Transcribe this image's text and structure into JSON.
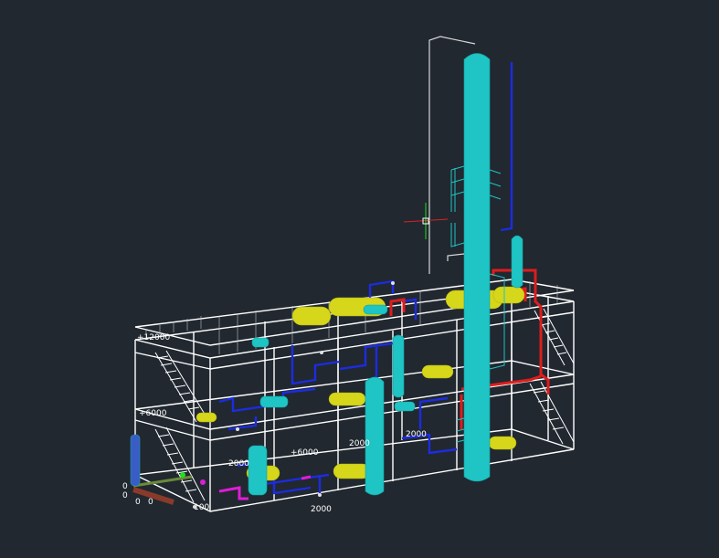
{
  "viewport": {
    "background": "#212830",
    "colors": {
      "structure": "#ffffff",
      "column": "#1fc4c4",
      "vessel_yellow": "#d6d61a",
      "pipe_blue": "#1c2ce0",
      "pipe_red": "#e01c1c",
      "pipe_magenta": "#e01cd6",
      "pipe_brown": "#8a3a2a",
      "equipment_cyan": "#1fc4c4",
      "ucs_green": "#20e020",
      "ucs_red": "#e02020"
    },
    "elevation_labels": [
      "+12000",
      "+6000",
      "2000",
      "+6000",
      "2000",
      "2000",
      "2000"
    ],
    "small_labels": [
      "0",
      "0",
      "0",
      "0",
      "100"
    ]
  }
}
